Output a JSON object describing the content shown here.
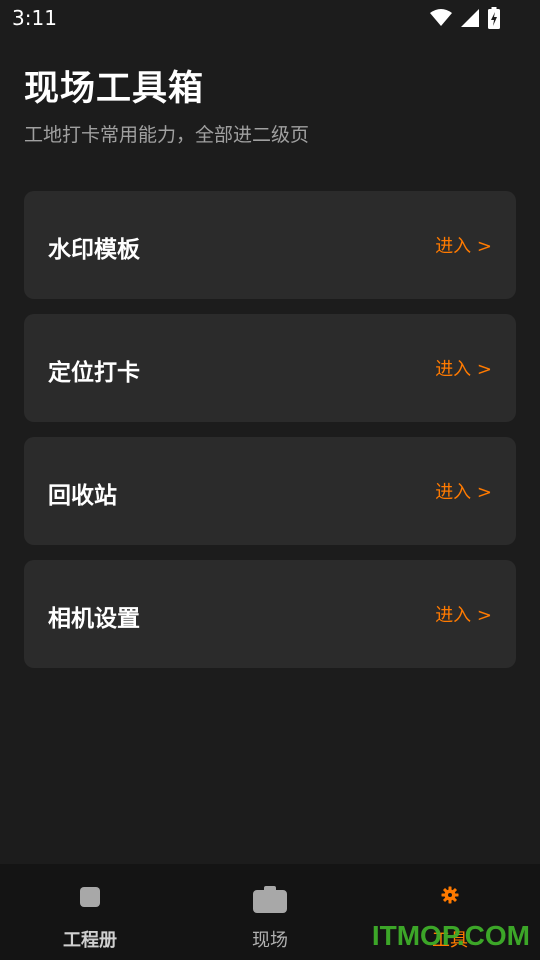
{
  "status_bar": {
    "time": "3:11",
    "icons": [
      "wifi-icon",
      "cellular-signal-icon",
      "battery-charging-icon"
    ]
  },
  "page": {
    "title": "现场工具箱",
    "subtitle": "工地打卡常用能力，全部进二级页"
  },
  "cards": [
    {
      "title": "水印模板",
      "action": "进入 >"
    },
    {
      "title": "定位打卡",
      "action": "进入 >"
    },
    {
      "title": "回收站",
      "action": "进入 >"
    },
    {
      "title": "相机设置",
      "action": "进入 >"
    }
  ],
  "bottom_nav": {
    "items": [
      {
        "label": "工程册",
        "icon": "album-icon",
        "active": false
      },
      {
        "label": "现场",
        "icon": "camera-icon",
        "active": false
      },
      {
        "label": "工具",
        "icon": "gear-icon",
        "active": true
      }
    ]
  },
  "watermark": {
    "text": "ITMOP.COM"
  },
  "colors": {
    "background": "#1c1c1c",
    "card": "#2b2b2b",
    "accent": "#ff7a00",
    "watermark": "#3fae2a"
  }
}
